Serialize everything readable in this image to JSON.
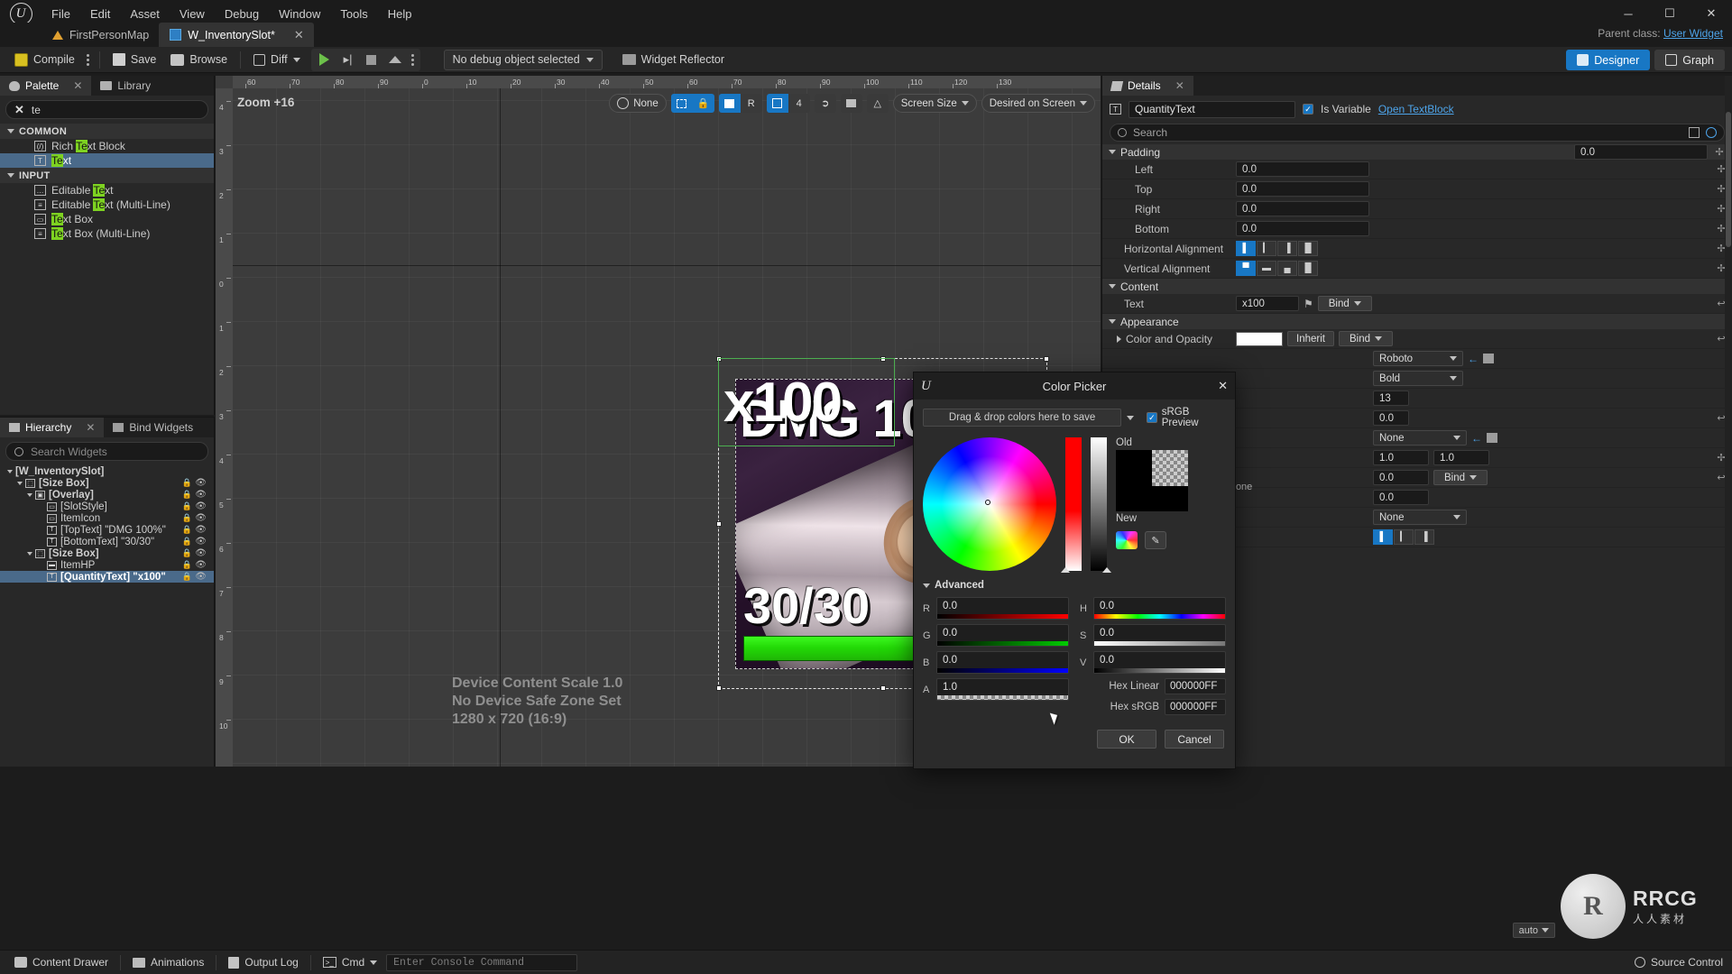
{
  "window": {
    "menu": [
      "File",
      "Edit",
      "Asset",
      "View",
      "Debug",
      "Window",
      "Tools",
      "Help"
    ],
    "minimize": "─",
    "maximize": "☐",
    "close": "✕"
  },
  "tabs": {
    "items": [
      {
        "label": "FirstPersonMap",
        "active": false,
        "dirty": false
      },
      {
        "label": "W_InventorySlot*",
        "active": true,
        "dirty": true
      }
    ],
    "close_glyph": "✕",
    "parent_class_label": "Parent class:",
    "parent_class_value": "User Widget"
  },
  "toolbar": {
    "compile": "Compile",
    "save": "Save",
    "browse": "Browse",
    "diff": "Diff",
    "debug_object": "No debug object selected",
    "widget_reflector": "Widget Reflector",
    "designer": "Designer",
    "graph": "Graph"
  },
  "palette": {
    "tab_palette": "Palette",
    "tab_library": "Library",
    "search_value": "te",
    "clear_glyph": "✕",
    "groups": [
      {
        "name": "COMMON",
        "items": [
          {
            "pre": "Rich ",
            "hl": "Te",
            "post": "xt Block",
            "icon": "(/)",
            "selected": false
          },
          {
            "pre": "",
            "hl": "Te",
            "post": "xt",
            "icon": "T",
            "selected": true
          }
        ]
      },
      {
        "name": "INPUT",
        "items": [
          {
            "pre": "Editable ",
            "hl": "Te",
            "post": "xt",
            "icon": "…",
            "selected": false
          },
          {
            "pre": "Editable ",
            "hl": "Te",
            "post": "xt (Multi-Line)",
            "icon": "≡",
            "selected": false
          },
          {
            "pre": "",
            "hl": "Te",
            "post": "xt Box",
            "icon": "▭",
            "selected": false
          },
          {
            "pre": "",
            "hl": "Te",
            "post": "xt Box (Multi-Line)",
            "icon": "≡",
            "selected": false
          }
        ]
      }
    ]
  },
  "hierarchy": {
    "tab_hierarchy": "Hierarchy",
    "tab_bind_widgets": "Bind Widgets",
    "search_placeholder": "Search Widgets",
    "rows": [
      {
        "label": "[W_InventorySlot]",
        "depth": 0,
        "arrow": true,
        "icon": "",
        "selected": false,
        "eye": false
      },
      {
        "label": "[Size Box]",
        "depth": 1,
        "arrow": true,
        "icon": "⬚",
        "selected": false,
        "eye": true
      },
      {
        "label": "[Overlay]",
        "depth": 2,
        "arrow": true,
        "icon": "▣",
        "selected": false,
        "eye": true
      },
      {
        "label": "[SlotStyle]",
        "depth": 3,
        "arrow": false,
        "icon": "▭",
        "selected": false,
        "eye": true
      },
      {
        "label": "ItemIcon",
        "depth": 3,
        "arrow": false,
        "icon": "▭",
        "selected": false,
        "eye": true
      },
      {
        "label": "[TopText] \"DMG 100%\"",
        "depth": 3,
        "arrow": false,
        "icon": "T",
        "selected": false,
        "eye": true
      },
      {
        "label": "[BottomText] \"30/30\"",
        "depth": 3,
        "arrow": false,
        "icon": "T",
        "selected": false,
        "eye": true
      },
      {
        "label": "[Size Box]",
        "depth": 2,
        "arrow": true,
        "icon": "⬚",
        "selected": false,
        "eye": true
      },
      {
        "label": "ItemHP",
        "depth": 3,
        "arrow": false,
        "icon": "▬",
        "selected": false,
        "eye": true
      },
      {
        "label": "[QuantityText] \"x100\"",
        "depth": 3,
        "arrow": false,
        "icon": "T",
        "selected": true,
        "eye": true
      }
    ]
  },
  "viewport": {
    "zoom_label": "Zoom +16",
    "none_label": "None",
    "grid_snap_value": "4",
    "screen_size": "Screen Size",
    "desired_on_screen": "Desired on Screen",
    "r_label": "R",
    "ruler_h_ticks": [
      "60",
      "70",
      "80",
      "90",
      "0",
      "10",
      "20",
      "30",
      "40",
      "50",
      "60",
      "70",
      "80",
      "90",
      "100",
      "110",
      "120",
      "130"
    ],
    "ruler_v_ticks": [
      "4",
      "3",
      "2",
      "1",
      "0",
      "1",
      "2",
      "3",
      "4",
      "5",
      "6",
      "7",
      "8",
      "9",
      "10"
    ],
    "device_lines": [
      "Device Content Scale 1.0",
      "No Device Safe Zone Set",
      "1280 x 720 (16:9)"
    ],
    "preview": {
      "top_text": "DMG 100%",
      "bottom_text": "30/30",
      "quantity_text": "x100",
      "hp_color": "#2fe00a"
    }
  },
  "details": {
    "title": "Details",
    "close_glyph": "✕",
    "widget_name": "QuantityText",
    "is_variable_label": "Is Variable",
    "open_textblock": "Open TextBlock",
    "search_placeholder": "Search",
    "categories": {
      "padding": "Padding",
      "content": "Content",
      "appearance": "Appearance"
    },
    "rows": [
      {
        "label": "Padding",
        "value": "0.0",
        "type": "cat_value"
      },
      {
        "label": "Left",
        "value": "0.0",
        "type": "num"
      },
      {
        "label": "Top",
        "value": "0.0",
        "type": "num"
      },
      {
        "label": "Right",
        "value": "0.0",
        "type": "num"
      },
      {
        "label": "Bottom",
        "value": "0.0",
        "type": "num"
      }
    ],
    "horizontal_alignment": "Horizontal Alignment",
    "vertical_alignment": "Vertical Alignment",
    "text_label": "Text",
    "text_value": "x100",
    "bind_label": "Bind",
    "color_and_opacity": "Color and Opacity",
    "inherit_label": "Inherit",
    "font_family": "Roboto",
    "font_style": "Bold",
    "font_size": "13",
    "outline_none": "None",
    "none_label": "None",
    "shadow_x": "1.0",
    "shadow_y": "1.0",
    "shadow_zero": "0.0",
    "misc_none": "None"
  },
  "color_picker": {
    "title": "Color Picker",
    "close_glyph": "✕",
    "drag_drop": "Drag & drop colors here to save",
    "srgb_preview": "sRGB Preview",
    "old_label": "Old",
    "new_label": "New",
    "advanced": "Advanced",
    "channels": [
      {
        "label": "R",
        "value": "0.0"
      },
      {
        "label": "G",
        "value": "0.0"
      },
      {
        "label": "B",
        "value": "0.0"
      },
      {
        "label": "A",
        "value": "1.0"
      }
    ],
    "hsv": [
      {
        "label": "H",
        "value": "0.0"
      },
      {
        "label": "S",
        "value": "0.0"
      },
      {
        "label": "V",
        "value": "0.0"
      }
    ],
    "hex_linear_label": "Hex Linear",
    "hex_linear_value": "000000FF",
    "hex_srgb_label": "Hex sRGB",
    "hex_srgb_value": "000000FF",
    "ok": "OK",
    "cancel": "Cancel",
    "old_color": "#000000",
    "new_color": "#000000"
  },
  "statusbar": {
    "content_drawer": "Content Drawer",
    "animations": "Animations",
    "output_log": "Output Log",
    "cmd": "Cmd",
    "console_placeholder": "Enter Console Command",
    "source_control": "Source Control",
    "auto_label": "auto"
  },
  "watermark": {
    "mark": "R",
    "line1": "RRCG",
    "line2": "人人素材"
  }
}
